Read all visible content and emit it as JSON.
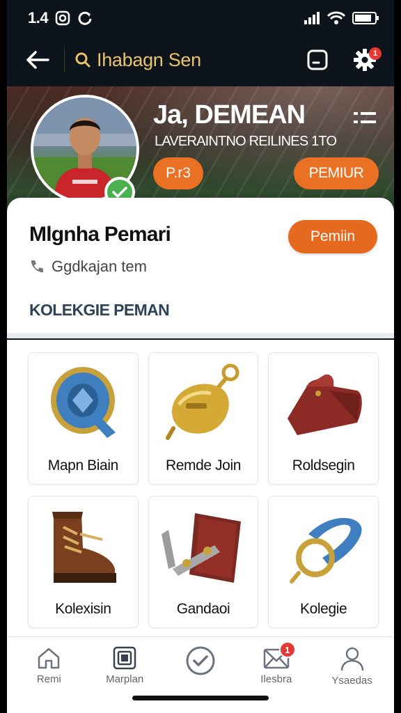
{
  "status_bar": {
    "time": "1.4"
  },
  "app_bar": {
    "search_text": "Ihabagn Sen",
    "notification_count": "1"
  },
  "hero": {
    "name": "Ja, DEMEAN",
    "subtitle": "LAVERAINTNO REILINES 1TO",
    "rank_label": "P.r3",
    "premium_label": "PEMIUR"
  },
  "profile": {
    "name": "Mlgnha Pemari",
    "button_label": "Pemiin",
    "meta_text": "Ggdkajan tem",
    "section_title": "KOLEKGIE PEMAN"
  },
  "items": [
    {
      "label": "Mapn Biain",
      "icon": "medal-badge-icon"
    },
    {
      "label": "Remde Join",
      "icon": "golden-capsule-icon"
    },
    {
      "label": "Roldsegin",
      "icon": "leather-pouch-icon"
    },
    {
      "label": "Kolexisin",
      "icon": "leather-boot-icon"
    },
    {
      "label": "Gandaoi",
      "icon": "book-and-lever-icon"
    },
    {
      "label": "Kolegie",
      "icon": "ring-bracelet-icon"
    }
  ],
  "nav": [
    {
      "label": "Remi",
      "icon": "home-icon"
    },
    {
      "label": "Marplan",
      "icon": "gallery-icon"
    },
    {
      "label": "",
      "icon": "check-circle-icon"
    },
    {
      "label": "Ilesbra",
      "icon": "mail-icon",
      "badge": "1"
    },
    {
      "label": "Ysaedas",
      "icon": "profile-icon"
    }
  ],
  "colors": {
    "accent": "#ea7024",
    "search_text": "#e9c46a",
    "verified": "#4caf50",
    "badge": "#e53935"
  }
}
